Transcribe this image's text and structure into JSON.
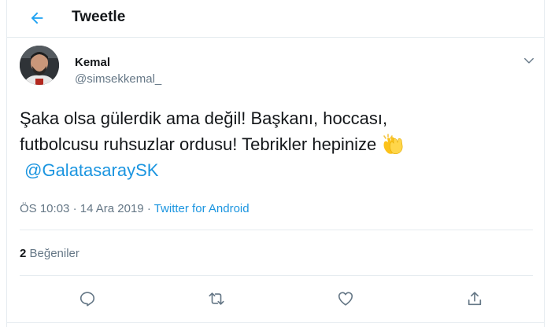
{
  "header": {
    "title": "Tweetle",
    "back_icon": "arrow-left-icon"
  },
  "tweet": {
    "author_name": "Kemal",
    "author_handle": "@simsekkemal_",
    "text_line1": "Şaka olsa gülerdik ama değil! Başkanı, hoccası,",
    "text_line2": "futbolcusu ruhsuzlar ordusu! Tebrikler hepinize",
    "emoji": "clapping-hands-icon",
    "mention": "@GalatasaraySK",
    "time": "ÖS 10:03",
    "separator1": "·",
    "date": "14 Ara 2019",
    "separator2": "·",
    "source": "Twitter for Android"
  },
  "stats": {
    "likes_count": "2",
    "likes_label": "Beğeniler"
  },
  "actions": [
    "reply-icon",
    "retweet-icon",
    "like-icon",
    "share-icon"
  ],
  "colors": {
    "accent": "#1da1f2",
    "link": "#1b95e0",
    "secondary_text": "#657786",
    "border": "#e6ecf0"
  }
}
